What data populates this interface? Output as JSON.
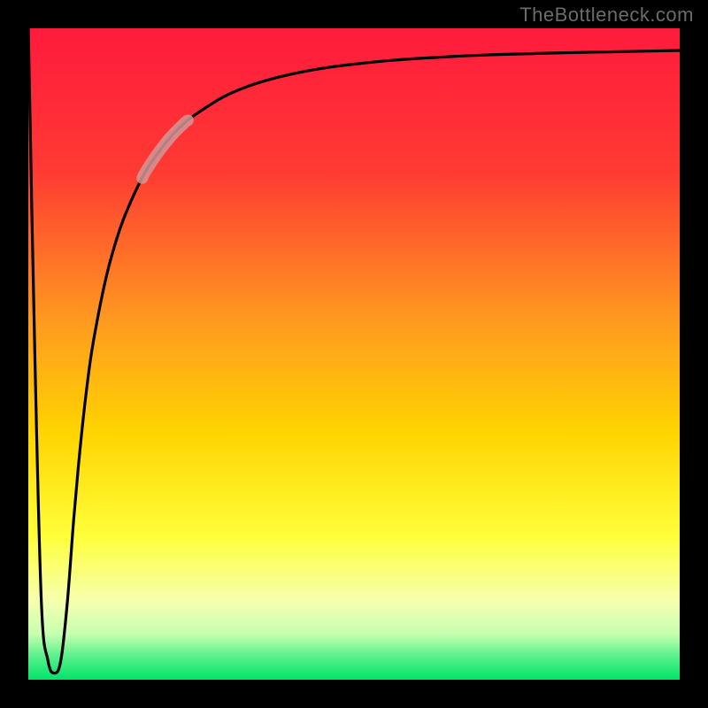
{
  "watermark": "TheBottleneck.com",
  "gradient_stops": [
    {
      "offset": 0.0,
      "color": "#ff1a3d"
    },
    {
      "offset": 0.22,
      "color": "#ff3a33"
    },
    {
      "offset": 0.45,
      "color": "#ff9a1f"
    },
    {
      "offset": 0.62,
      "color": "#ffd400"
    },
    {
      "offset": 0.78,
      "color": "#ffff3a"
    },
    {
      "offset": 0.88,
      "color": "#f6ffb0"
    },
    {
      "offset": 0.93,
      "color": "#c6ffb0"
    },
    {
      "offset": 0.965,
      "color": "#57f08a"
    },
    {
      "offset": 1.0,
      "color": "#00e46a"
    }
  ],
  "curve_color": "#000000",
  "highlight_color": "rgba(210,150,150,0.85)",
  "highlight_range_x": [
    0.175,
    0.245
  ],
  "chart_data": {
    "type": "line",
    "title": "",
    "xlabel": "",
    "ylabel": "",
    "xlim": [
      0,
      1
    ],
    "ylim": [
      0,
      1
    ],
    "series": [
      {
        "name": "bottleneck-curve",
        "x": [
          0.0,
          0.01,
          0.02,
          0.03,
          0.04,
          0.05,
          0.06,
          0.07,
          0.08,
          0.09,
          0.1,
          0.12,
          0.14,
          0.16,
          0.18,
          0.2,
          0.22,
          0.24,
          0.26,
          0.3,
          0.34,
          0.38,
          0.42,
          0.46,
          0.5,
          0.56,
          0.62,
          0.7,
          0.8,
          0.9,
          1.0
        ],
        "y": [
          1.0,
          0.5,
          0.12,
          0.03,
          0.01,
          0.03,
          0.12,
          0.25,
          0.36,
          0.45,
          0.52,
          0.62,
          0.69,
          0.74,
          0.78,
          0.81,
          0.835,
          0.855,
          0.87,
          0.895,
          0.912,
          0.924,
          0.933,
          0.94,
          0.945,
          0.951,
          0.955,
          0.959,
          0.962,
          0.964,
          0.966
        ]
      }
    ],
    "notes": "y represents distance from bottom (0) to top (1); the plotted curve drops sharply from top-left to a minimum near x≈0.04, then rises asymptotically toward y≈0.97 at the right edge. A pale-pink highlight overlays the curve roughly over x∈[0.175,0.245]."
  }
}
